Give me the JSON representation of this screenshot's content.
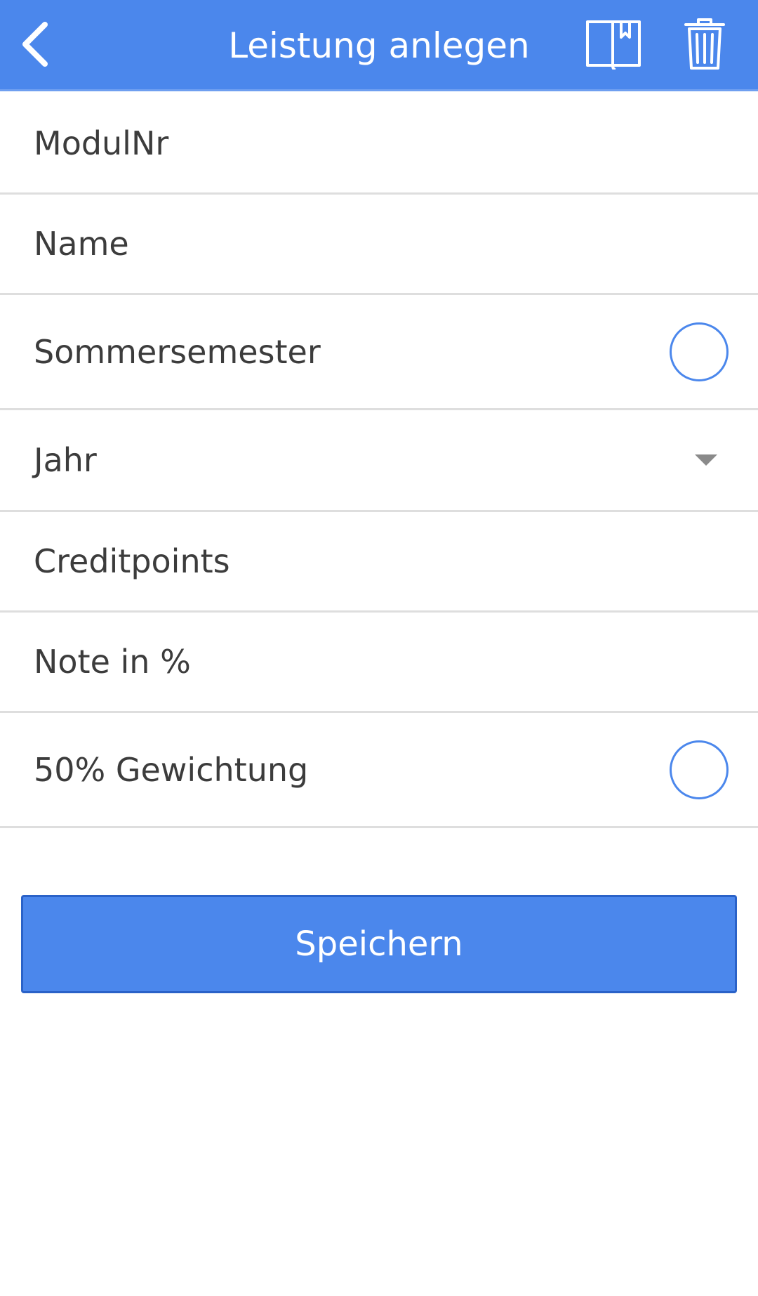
{
  "header": {
    "title": "Leistung anlegen",
    "back_icon": "chevron-left-icon",
    "book_icon": "bookmark-book-icon",
    "trash_icon": "trash-icon",
    "background_color": "#4b87ec"
  },
  "form": {
    "modul_nr": {
      "placeholder": "ModulNr"
    },
    "name": {
      "placeholder": "Name"
    },
    "sommersemester": {
      "label": "Sommersemester",
      "checked": false
    },
    "jahr": {
      "label": "Jahr"
    },
    "creditpoints": {
      "placeholder": "Creditpoints"
    },
    "note": {
      "placeholder": "Note in %"
    },
    "gewichtung": {
      "label": "50% Gewichtung",
      "checked": false
    }
  },
  "actions": {
    "save_label": "Speichern"
  },
  "colors": {
    "accent": "#4b87ec",
    "divider": "#dedede",
    "text": "#3c3c3c"
  }
}
